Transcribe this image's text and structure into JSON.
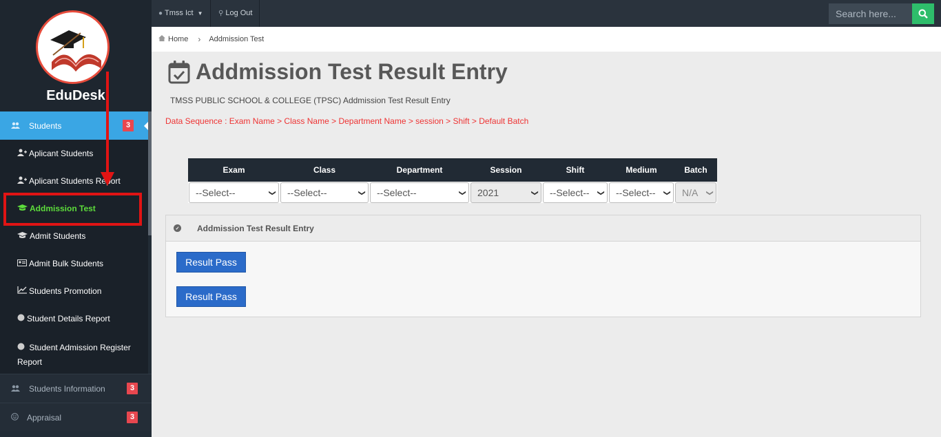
{
  "sidebar": {
    "brand": "EduDesk",
    "students": {
      "label": "Students",
      "badge": "3"
    },
    "sub_items": [
      {
        "label": "Aplicant Students",
        "icon": "user-plus-icon"
      },
      {
        "label": "Aplicant Students Report",
        "icon": "user-plus-icon"
      },
      {
        "label": "Addmission Test",
        "icon": "graduation-cap-icon"
      },
      {
        "label": "Admit Students",
        "icon": "graduation-cap-icon"
      },
      {
        "label": "Admit Bulk Students",
        "icon": "id-card-icon"
      },
      {
        "label": "Students Promotion",
        "icon": "line-chart-icon"
      },
      {
        "label": "Student Details Report",
        "icon": "circle-icon"
      },
      {
        "label": "Student Admission Register Report",
        "icon": "circle-icon"
      }
    ],
    "students_information": {
      "label": "Students Information",
      "badge": "3"
    },
    "appraisal": {
      "label": "Appraisal",
      "badge": "3"
    }
  },
  "topbar": {
    "user": "Tmss Ict",
    "logout": "Log Out",
    "search_placeholder": "Search here..."
  },
  "breadcrumb": {
    "home": "Home",
    "current": "Addmission Test"
  },
  "page": {
    "title": "Addmission Test Result Entry",
    "subtitle": "TMSS PUBLIC SCHOOL & COLLEGE (TPSC) Addmission Test Result Entry",
    "sequence": "Data Sequence : Exam Name > Class Name > Department Name > session > Shift > Default Batch"
  },
  "filters": {
    "headers": [
      "Exam",
      "Class",
      "Department",
      "Session",
      "Shift",
      "Medium",
      "Batch"
    ],
    "values": [
      "--Select--",
      "--Select--",
      "--Select--",
      "2021",
      "--Select--",
      "--Select--",
      "N/A"
    ]
  },
  "panel": {
    "title": "Addmission Test Result Entry",
    "button1": "Result Pass",
    "button2": "Result Pass"
  },
  "colors": {
    "sidebar_active": "#3aa6e4",
    "badge": "#e8474f",
    "current_item": "#5ddc3b",
    "annotation": "#e11414",
    "button": "#2b6bc9",
    "search_button": "#2ebd6b"
  }
}
